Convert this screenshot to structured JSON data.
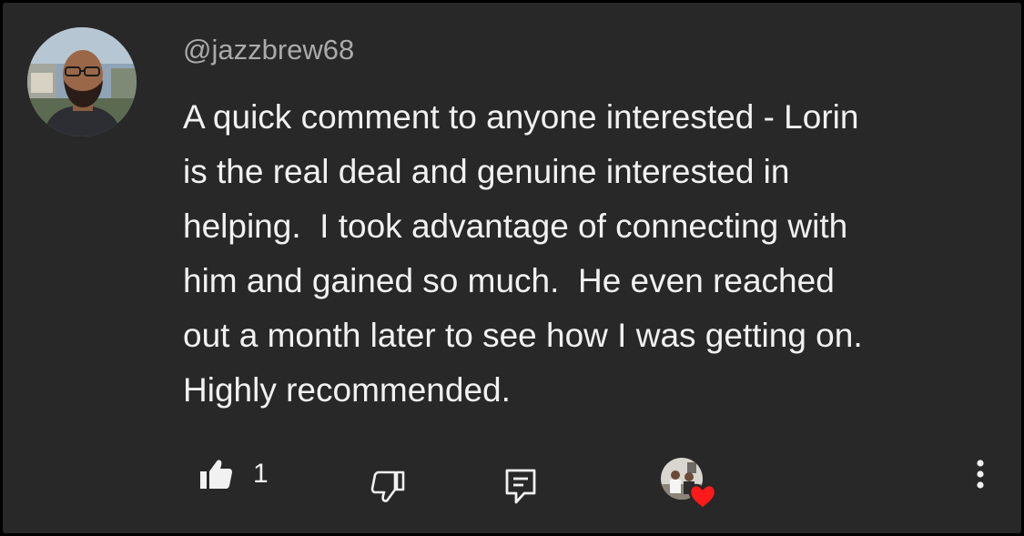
{
  "comment": {
    "username": "@jazzbrew68",
    "text_lines": [
      "A quick comment to anyone interested - Lorin",
      "is the real deal and genuine interested in",
      "helping.  I took advantage of connecting with",
      "him and gained so much.  He even reached",
      "out a month later to see how I was getting on.",
      "Highly recommended."
    ]
  },
  "actions": {
    "like_count": "1",
    "icons": [
      "thumbs-up-icon",
      "thumbs-down-icon",
      "reply-icon",
      "creator-heart-icon",
      "more-vertical-icon"
    ]
  },
  "colors": {
    "background": "#282828",
    "text": "#f1f1f1",
    "username": "#aaaaaa",
    "heart": "#ff1a1a"
  }
}
